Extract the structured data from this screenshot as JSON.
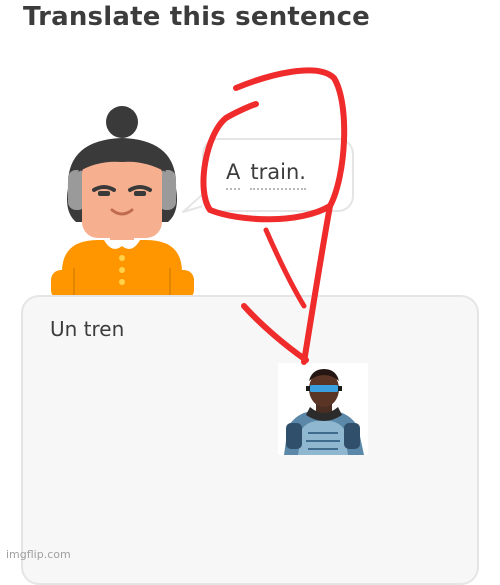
{
  "header": {
    "title": "Translate this sentence"
  },
  "prompt": {
    "words": [
      "A",
      "train."
    ]
  },
  "answer": {
    "text": "Un tren"
  },
  "watermark": "imgflip.com",
  "colors": {
    "text": "#3c3c3c",
    "border": "#e5e5e5",
    "card_bg": "#f7f7f7",
    "scribble": "#ef2b2b",
    "shirt": "#ff9600"
  },
  "icons": {
    "character": "duolingo-character-lily",
    "pasted_image": "superhero-figure"
  }
}
